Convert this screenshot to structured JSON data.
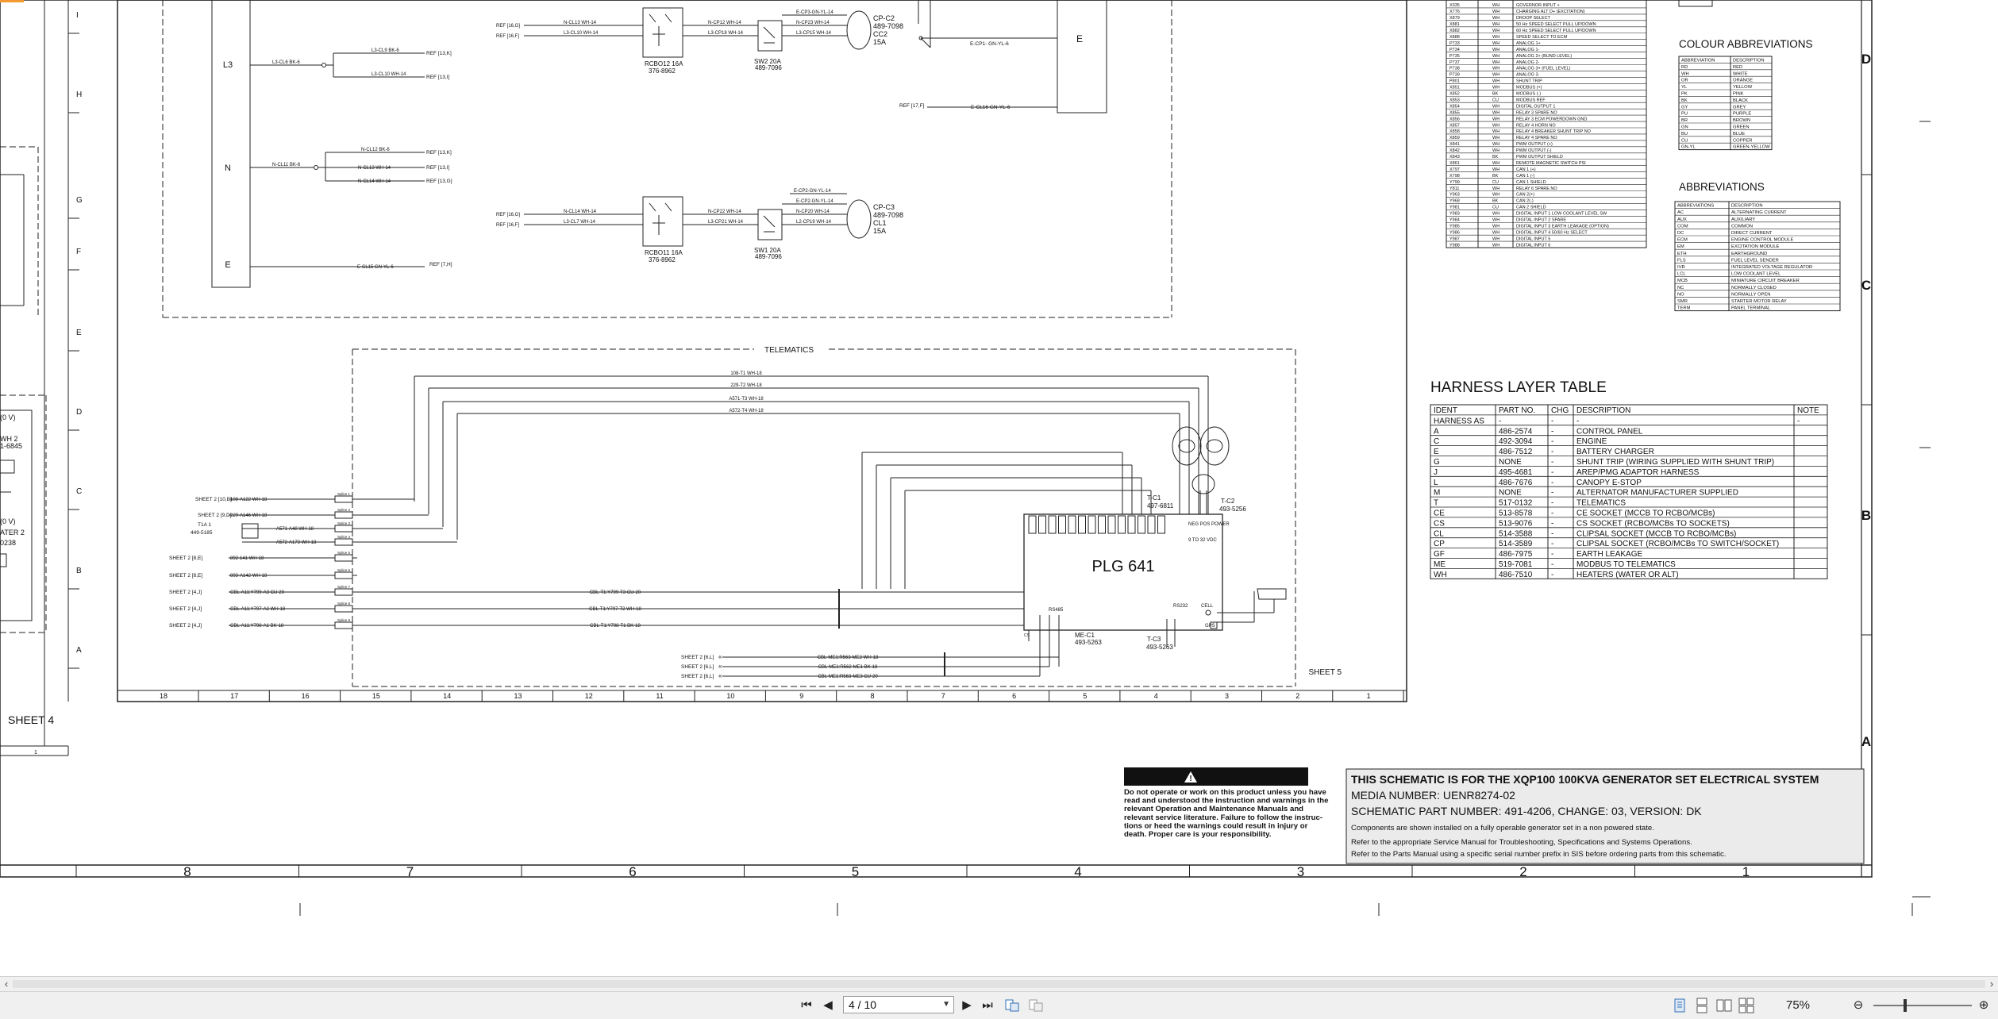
{
  "viewer": {
    "page_current": "4 / 10",
    "zoom": "75%"
  },
  "left_fragment": {
    "label1": "(0 V)",
    "label2": "WH 2",
    "label3": "1-6845",
    "label4": "(0 V)",
    "label5": "ATER 2",
    "label6": "0238",
    "sheet_label": "SHEET 4"
  },
  "grid": {
    "row_letters": [
      "I",
      "H",
      "G",
      "F",
      "E",
      "D",
      "C",
      "B",
      "A"
    ],
    "column_numbers": [
      "18",
      "17",
      "16",
      "15",
      "14",
      "13",
      "12",
      "11",
      "10",
      "9",
      "8",
      "7",
      "6",
      "5",
      "4",
      "3",
      "2",
      "1"
    ],
    "outer_columns": [
      "8",
      "7",
      "6",
      "5",
      "4",
      "3",
      "2",
      "1"
    ],
    "outer_rows": [
      "D",
      "C",
      "B",
      "A"
    ]
  },
  "schematic": {
    "bus_labels": [
      "L3",
      "N",
      "E"
    ],
    "l3_wires": [
      "L3-CL6 BK-6",
      "L3-CL9 BK-6",
      "L3-CL10 WH-14"
    ],
    "l3_refs": [
      "REF [13,K]",
      "REF [13,I]"
    ],
    "n_wires": [
      "N-CL11 BK-6",
      "N-CL12 BK-6",
      "N-CL13 WH-14",
      "N-CL14 WH-14"
    ],
    "n_refs": [
      "REF [13,K]",
      "REF [13,I]",
      "REF [13,G]"
    ],
    "e_wire": "E-CL15 GN-YL-6",
    "e_ref": "REF [7,H]",
    "upper_circuit": {
      "in_refs": [
        "REF [16,G]",
        "REF [16,F]"
      ],
      "in_wires": [
        "N-CL13 WH-14",
        "L3-CL10 WH-14"
      ],
      "out_wires": [
        "N-CP12 WH-14",
        "L3-CP18 WH-14"
      ],
      "sw_wires": [
        "N-CP23 WH-14",
        "L3-CP15 WH-14"
      ],
      "earth_wire": "E-CP3-GN-YL-14",
      "rcbo_label": "RCBO12 16A",
      "rcbo_part": "376-8962",
      "sw_label": "SW2 20A",
      "sw_part": "489-7096",
      "cp_label": "CP-C2",
      "cp_part": "489-7098",
      "cp_link": "CC2",
      "cp_rating": "15A",
      "out_earth": "E-CP1- GN-YL-6",
      "ref_right": "REF [17,F]",
      "ref_right_wire": "E-CL16 GN-YL-6",
      "e_box": "E"
    },
    "lower_circuit": {
      "in_refs": [
        "REF [16,G]",
        "REF [16,F]"
      ],
      "in_wires": [
        "N-CL14 WH-14",
        "L3-CL7 WH-14"
      ],
      "out_wires": [
        "N-CP22 WH-14",
        "L3-CP21 WH-14"
      ],
      "sw_wires": [
        "N-CP20 WH-14",
        "L2-CP19 WH-14"
      ],
      "earth_wire": "E-CP2-GN-YL-14",
      "rcbo_label": "RCBO11 16A",
      "rcbo_part": "376-8962",
      "sw_label": "SW1 20A",
      "sw_part": "489-7096",
      "cp_label": "CP-C3",
      "cp_part": "489-7098",
      "cp_link": "CL1",
      "cp_rating": "15A"
    },
    "telematics": {
      "title": "TELEMATICS",
      "top_wires": [
        "108-T1 WH-18",
        "229-T2 WH-18",
        "A571-T3 WH-18",
        "A572-T4 WH-18"
      ],
      "left_sheet_refs": [
        "SHEET 2 [10,E]",
        "SHEET 2 [9,D]",
        "T1A 1",
        "SHEET 2 [9,E]",
        "SHEET 2 [8,E]",
        "SHEET 2 [4,J]",
        "SHEET 2 [4,J]",
        "SHEET 2 [4,J]"
      ],
      "left_wires": [
        "108-A122 WH-18",
        "229-A146 WH-18",
        "A571-A48 WH-18",
        "A572-A173 WH-18",
        "892-141 WH-18",
        "893-A142 WH-18",
        "CBL-A11:Y799-A3 CU-20",
        "CBL-A11:Y797-A2 WH-18",
        "CBL-A11:Y798-A1 BK-18"
      ],
      "t1a_part": "449-5185",
      "right_cables": [
        "CBL-T1:Y799-T3 CU-20",
        "CBL-T1:Y797-T2 WH-18",
        "CBL-T1:Y798-T1 BK-18"
      ],
      "bottom_refs": [
        "SHEET 2 [6,L]",
        "SHEET 2 [6,L]",
        "SHEET 2 [6,L]"
      ],
      "bottom_wires": [
        "CBL-ME1:R563-ME2 WH-18",
        "CBL-ME1:R562-ME1 BK-18",
        "CBL-ME1:R563-ME3 CU-20"
      ],
      "plg_label": "PLG 641",
      "tc1_label": "T-C1",
      "tc1_part": "497-6811",
      "tc2_label": "T-C2",
      "tc2_part": "493-5256",
      "tc3_label": "T-C3",
      "tc3_part": "493-5263",
      "mec1_label": "ME-C1",
      "mec1_part": "493-5263",
      "power_label": "NEG POS POWER",
      "power_volts": "9 TO 32 VDC",
      "port_labels": [
        "RS485",
        "RS232",
        "CELL",
        "GPS"
      ],
      "sheet_label": "SHEET 5"
    }
  },
  "colour_abbreviations": {
    "title": "COLOUR ABBREVIATIONS",
    "header": [
      "ABBREVIATION",
      "DESCRIPTION"
    ],
    "rows": [
      [
        "RD",
        "RED"
      ],
      [
        "WH",
        "WHITE"
      ],
      [
        "OR",
        "ORANGE"
      ],
      [
        "YL",
        "YELLOW"
      ],
      [
        "PK",
        "PINK"
      ],
      [
        "BK",
        "BLACK"
      ],
      [
        "GY",
        "GREY"
      ],
      [
        "PU",
        "PURPLE"
      ],
      [
        "BR",
        "BROWN"
      ],
      [
        "GN",
        "GREEN"
      ],
      [
        "BU",
        "BLUE"
      ],
      [
        "CU",
        "COPPER"
      ],
      [
        "GN-YL",
        "GREEN-YELLOW"
      ]
    ]
  },
  "abbreviations": {
    "title": "ABBREVIATIONS",
    "header": [
      "ABBREVIATIONS",
      "DESCRIPTION"
    ],
    "rows": [
      [
        "AC",
        "ALTERNATING CURRENT"
      ],
      [
        "AUX",
        "AUXILIARY"
      ],
      [
        "COM",
        "COMMON"
      ],
      [
        "DC",
        "DIRECT CURRENT"
      ],
      [
        "ECM",
        "ENGINE CONTROL MODULE"
      ],
      [
        "EM",
        "EXCITATION MODULE"
      ],
      [
        "ETH",
        "EARTHGROUND"
      ],
      [
        "FLS",
        "FUEL LEVEL SENDER"
      ],
      [
        "IVR",
        "INTEGRATED VOLTAGE REGULATOR"
      ],
      [
        "LCL",
        "LOW COOLANT LEVEL"
      ],
      [
        "MCB",
        "MINIATURE CIRCUIT BREAKER"
      ],
      [
        "NC",
        "NORMALLY CLOSED"
      ],
      [
        "NO",
        "NORMALLY OPEN"
      ],
      [
        "SMR",
        "STARTER MOTOR RELAY"
      ],
      [
        "TERM",
        "PANEL TERMINAL"
      ]
    ]
  },
  "wire_table": {
    "rows": [
      [
        "X335",
        "WH",
        "GOVERNOR INPUT +"
      ],
      [
        "X776",
        "WH",
        "CHARGING ALT D+ (EXCITATION)"
      ],
      [
        "X879",
        "WH",
        "DROOP SELECT"
      ],
      [
        "X881",
        "WH",
        "50 Hz SPEED SELECT PULL UP/DOWN"
      ],
      [
        "X882",
        "WH",
        "60 Hz SPEED SELECT PULL UP/DOWN"
      ],
      [
        "X888",
        "WH",
        "SPEED SELECT TO ECM"
      ],
      [
        "P733",
        "WH",
        "ANALOG 1+"
      ],
      [
        "P734",
        "WH",
        "ANALOG 1-"
      ],
      [
        "P735",
        "WH",
        "ANALOG 2+ (BUND LEVEL)"
      ],
      [
        "P737",
        "WH",
        "ANALOG 2-"
      ],
      [
        "P738",
        "WH",
        "ANALOG 3+ (FUEL LEVEL)"
      ],
      [
        "P739",
        "WH",
        "ANALOG 3-"
      ],
      [
        "P801",
        "WH",
        "SHUNT TRIP"
      ],
      [
        "X851",
        "WH",
        "MODBUS (+)"
      ],
      [
        "X852",
        "BK",
        "MODBUS (-)"
      ],
      [
        "X853",
        "CU",
        "MODBUS REF"
      ],
      [
        "X854",
        "WH",
        "DIGITAL OUTPUT 1"
      ],
      [
        "X855",
        "WH",
        "RELAY 3 SPARE NO"
      ],
      [
        "X856",
        "WH",
        "RELAY 3 ECM POWERDOWN GND"
      ],
      [
        "X857",
        "WH",
        "RELAY 4 HORN NO"
      ],
      [
        "X858",
        "WH",
        "RELAY 4 BREAKER SHUNT TRIP NO"
      ],
      [
        "X859",
        "WH",
        "RELAY 4 SPARE NO"
      ],
      [
        "X841",
        "WH",
        "PWM OUTPUT (+)"
      ],
      [
        "X842",
        "WH",
        "PWM OUTPUT (-)"
      ],
      [
        "X843",
        "BK",
        "PWM OUTPUT SHIELD"
      ],
      [
        "X861",
        "WH",
        "REMOTE MAGNETIC SWITCH PSI"
      ],
      [
        "X797",
        "WH",
        "CAN 1 (+)"
      ],
      [
        "X798",
        "BK",
        "CAN 1 (-)"
      ],
      [
        "Y799",
        "CU",
        "CAN 1 SHIELD"
      ],
      [
        "Y811",
        "WH",
        "RELAY 6 SPARE NO"
      ],
      [
        "Y963",
        "WH",
        "CAN 2(+)"
      ],
      [
        "Y968",
        "BK",
        "CAN 2(-)"
      ],
      [
        "Y981",
        "CU",
        "CAN 2 SHIELD"
      ],
      [
        "Y983",
        "WH",
        "DIGITAL INPUT 1 LOW COOLANT LEVEL SW"
      ],
      [
        "Y984",
        "WH",
        "DIGITAL INPUT 2 SPARE"
      ],
      [
        "Y985",
        "WH",
        "DIGITAL INPUT 3 EARTH LEAKAGE (OPTION)"
      ],
      [
        "Y986",
        "WH",
        "DIGITAL INPUT 4 50/60 Hz SELECT"
      ],
      [
        "Y987",
        "WH",
        "DIGITAL INPUT 5"
      ],
      [
        "Y988",
        "WH",
        "DIGITAL INPUT 6"
      ]
    ]
  },
  "harness_layer_table": {
    "title": "HARNESS LAYER TABLE",
    "header": [
      "IDENT",
      "PART NO.",
      "CHG",
      "DESCRIPTION",
      "NOTE"
    ],
    "rows": [
      [
        "HARNESS AS",
        "-",
        "-",
        "-",
        "-"
      ],
      [
        "A",
        "486-2574",
        "-",
        "CONTROL PANEL",
        ""
      ],
      [
        "C",
        "492-3094",
        "-",
        "ENGINE",
        ""
      ],
      [
        "E",
        "486-7512",
        "-",
        "BATTERY CHARGER",
        ""
      ],
      [
        "G",
        "NONE",
        "-",
        "SHUNT TRIP (WIRING SUPPLIED WITH SHUNT TRIP)",
        ""
      ],
      [
        "J",
        "495-4681",
        "-",
        "AREP/PMG ADAPTOR HARNESS",
        ""
      ],
      [
        "L",
        "486-7676",
        "-",
        "CANOPY E-STOP",
        ""
      ],
      [
        "M",
        "NONE",
        "-",
        "ALTERNATOR MANUFACTURER SUPPLIED",
        ""
      ],
      [
        "T",
        "517-0132",
        "-",
        "TELEMATICS",
        ""
      ],
      [
        "CE",
        "513-8578",
        "-",
        "CE SOCKET (MCCB TO RCBO/MCBs)",
        ""
      ],
      [
        "CS",
        "513-9076",
        "-",
        "CS SOCKET (RCBO/MCBs TO SOCKETS)",
        ""
      ],
      [
        "CL",
        "514-3588",
        "-",
        "CLIPSAL SOCKET (MCCB TO RCBO/MCBs)",
        ""
      ],
      [
        "CP",
        "514-3589",
        "-",
        "CLIPSAL SOCKET (RCBO/MCBs TO SWITCH/SOCKET)",
        ""
      ],
      [
        "GF",
        "486-7975",
        "-",
        "EARTH LEAKAGE",
        ""
      ],
      [
        "ME",
        "519-7081",
        "-",
        "MODBUS TO TELEMATICS",
        ""
      ],
      [
        "WH",
        "486-7510",
        "-",
        "HEATERS (WATER OR ALT)",
        ""
      ]
    ]
  },
  "warning": {
    "title": "WARNING",
    "lines": [
      "Do not operate or work on this product unless you have",
      "read and understood the instruction and warnings in the",
      "relevant Operation and Maintenance Manuals and",
      "relevant service literature. Failure to follow the instruc-",
      "tions or heed the warnings could result in injury or",
      "death. Proper care is your responsibility."
    ]
  },
  "title_block": {
    "title": "THIS SCHEMATIC IS FOR THE XQP100 100KVA GENERATOR SET ELECTRICAL SYSTEM",
    "media": "MEDIA NUMBER: UENR8274-02",
    "part": "SCHEMATIC PART NUMBER: 491-4206, CHANGE: 03, VERSION: DK",
    "note1": "Components are shown installed on a fully operable generator set in a non powered state.",
    "note2": "Refer to the appropriate Service Manual for Troubleshooting, Specifications and Systems Operations.",
    "note3": "Refer to the Parts Manual using a specific serial number prefix in SIS before ordering parts from this schematic."
  }
}
